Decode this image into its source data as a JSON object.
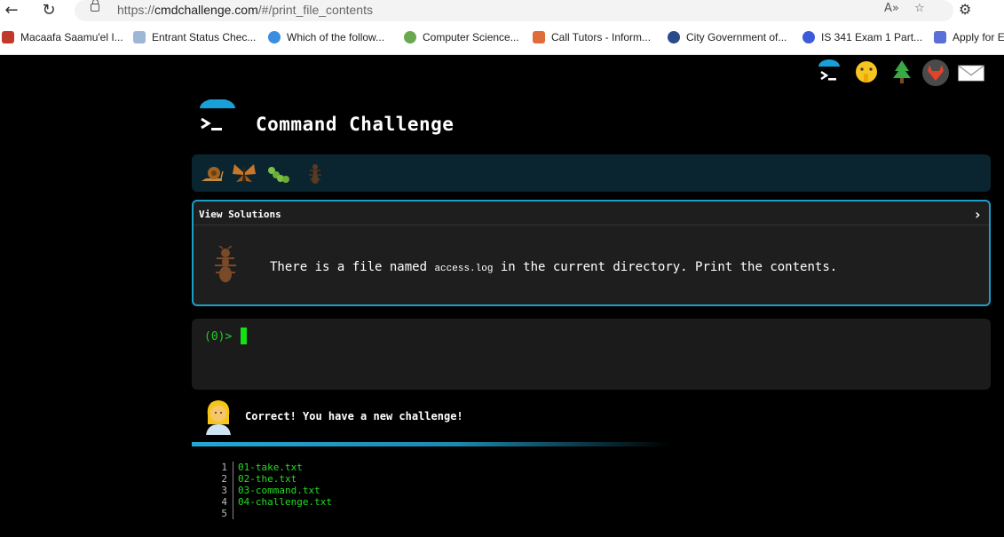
{
  "browser": {
    "url_scheme": "https://",
    "url_host": "cmdchallenge.com",
    "url_path": "/#/print_file_contents",
    "bookmarks": [
      {
        "label": "Macaafa Saamu'el I...",
        "icon": "book-icon",
        "color": "#c0392b"
      },
      {
        "label": "Entrant Status Chec...",
        "icon": "document-icon",
        "color": "#9fb7d6"
      },
      {
        "label": "Which of the follow...",
        "icon": "upload-circle-icon",
        "color": "#3b8de0"
      },
      {
        "label": "Computer Science...",
        "icon": "swirl-icon",
        "color": "#6aa84f"
      },
      {
        "label": "Call Tutors - Inform...",
        "icon": "graduation-cap-icon",
        "color": "#e06b3b"
      },
      {
        "label": "City Government of...",
        "icon": "seal-icon",
        "color": "#2c4a8a"
      },
      {
        "label": "IS 341 Exam 1 Part...",
        "icon": "q-icon",
        "color": "#3b5bdb"
      },
      {
        "label": "Apply for E",
        "icon": "wings-icon",
        "color": "#5b6fd8"
      }
    ]
  },
  "site": {
    "title": "Command Challenge",
    "view_solutions": "View Solutions",
    "challenge_text_before": "There is a file named ",
    "challenge_code": "access.log",
    "challenge_text_after": " in the current directory. Print the contents.",
    "prompt": "(0)>",
    "result": "Correct! You have a new challenge!",
    "accent_color": "#1aa0c8",
    "terminal_green": "#22dd22"
  },
  "output_lines": [
    {
      "num": "1",
      "text": "01-take.txt"
    },
    {
      "num": "2",
      "text": "02-the.txt"
    },
    {
      "num": "3",
      "text": "03-command.txt"
    },
    {
      "num": "4",
      "text": "04-challenge.txt"
    },
    {
      "num": "5",
      "text": ""
    }
  ]
}
